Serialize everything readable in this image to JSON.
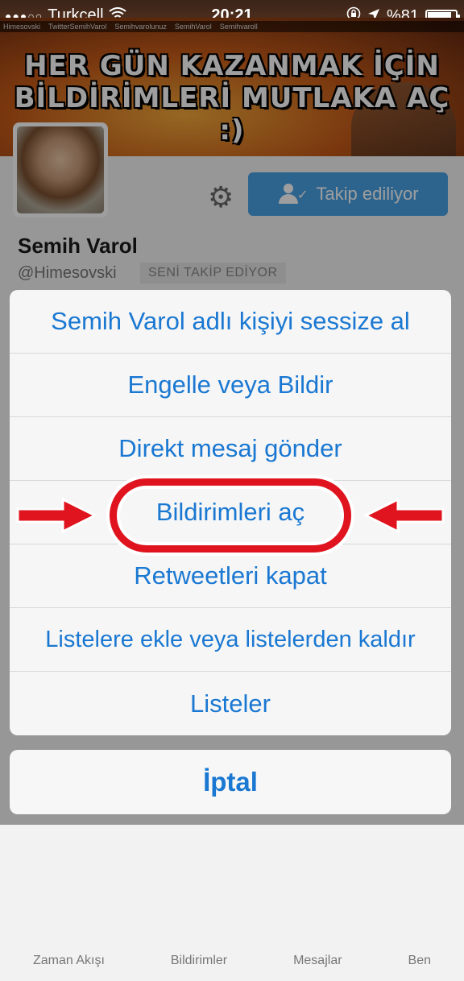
{
  "status_bar": {
    "signal_dots": "●●●○○",
    "carrier": "Turkcell",
    "time": "20:21",
    "battery": "%81",
    "battery_level": 0.81
  },
  "banner": {
    "social_handles": [
      "Himesovski",
      "TwitterSemihVarol",
      "Semihvarolunuz",
      "SemihVarol",
      "Semihvaroll"
    ],
    "title_line1": "HER GÜN KAZANMAK İÇİN",
    "title_line2": "BİLDİRİMLERİ MUTLAKA AÇ :)"
  },
  "profile": {
    "name": "Semih Varol",
    "handle": "@Himesovski",
    "follows_you_badge": "SENİ TAKİP EDİYOR",
    "follow_button_label": "Takip ediliyor"
  },
  "action_sheet": {
    "items": [
      "Semih Varol adlı kişiyi sessize al",
      "Engelle veya Bildir",
      "Direkt mesaj gönder",
      "Bildirimleri aç",
      "Retweetleri kapat",
      "Listelere ekle veya listelerden kaldır",
      "Listeler"
    ],
    "cancel_label": "İptal"
  },
  "background_tabs": [
    "Zaman Akışı",
    "Bildirimler",
    "Mesajlar",
    "Ben"
  ],
  "colors": {
    "accent": "#1a78d2",
    "follow_button": "#4aa2e6",
    "highlight": "#e0141e"
  }
}
